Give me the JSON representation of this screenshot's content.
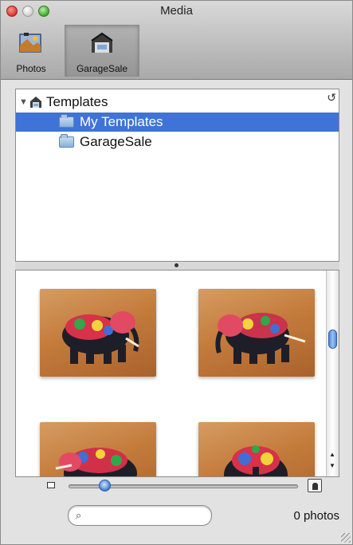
{
  "window": {
    "title": "Media"
  },
  "toolbar": {
    "items": [
      {
        "label": "Photos",
        "icon": "photos-icon"
      },
      {
        "label": "GarageSale",
        "icon": "garagesale-icon",
        "selected": true
      }
    ]
  },
  "source_list": {
    "root": {
      "label": "Templates",
      "expanded": true
    },
    "items": [
      {
        "label": "My Templates",
        "selected": true
      },
      {
        "label": "GarageSale",
        "selected": false
      }
    ]
  },
  "browser": {
    "thumbnails": 4,
    "scroll_fraction": 0.25
  },
  "bottom": {
    "search": {
      "value": "",
      "placeholder": ""
    },
    "count": "0 photos",
    "zoom_fraction": 0.15
  },
  "colors": {
    "selection": "#3f73d6",
    "accent": "#3e7ad6"
  }
}
